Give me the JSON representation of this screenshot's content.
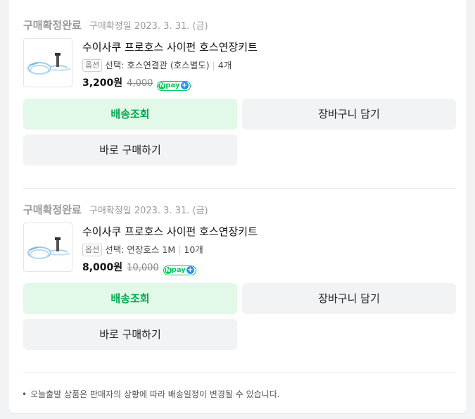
{
  "orders": [
    {
      "status": "구매확정완료",
      "confirm_date": "구매확정일 2023. 3. 31. (금)",
      "product_name": "수이사쿠 프로호스 사이펀 호스연장키트",
      "option_badge": "옵션",
      "option_text": "선택: 호스연결관 (호스별도)",
      "quantity": "4개",
      "price": "3,200원",
      "original_price": "4,000",
      "buttons": {
        "track": "배송조회",
        "cart": "장바구니 담기",
        "buy": "바로 구매하기"
      }
    },
    {
      "status": "구매확정완료",
      "confirm_date": "구매확정일 2023. 3. 31. (금)",
      "product_name": "수이사쿠 프로호스 사이펀 호스연장키트",
      "option_badge": "옵션",
      "option_text": "선택: 연장호스 1M",
      "quantity": "10개",
      "price": "8,000원",
      "original_price": "10,000",
      "buttons": {
        "track": "배송조회",
        "cart": "장바구니 담기",
        "buy": "바로 구매하기"
      }
    }
  ],
  "npay": {
    "n": "N",
    "label": "pay",
    "plus": "+"
  },
  "notice": "오늘출발 상품은 판매자의 상황에 따라 배송일정이 변경될 수 있습니다.",
  "colors": {
    "track_bg": "#e2f8e9",
    "track_text": "#03a94d",
    "npay_green": "#03c75a",
    "npay_plus": "#2b8ef0",
    "button_bg": "#f2f3f5"
  }
}
